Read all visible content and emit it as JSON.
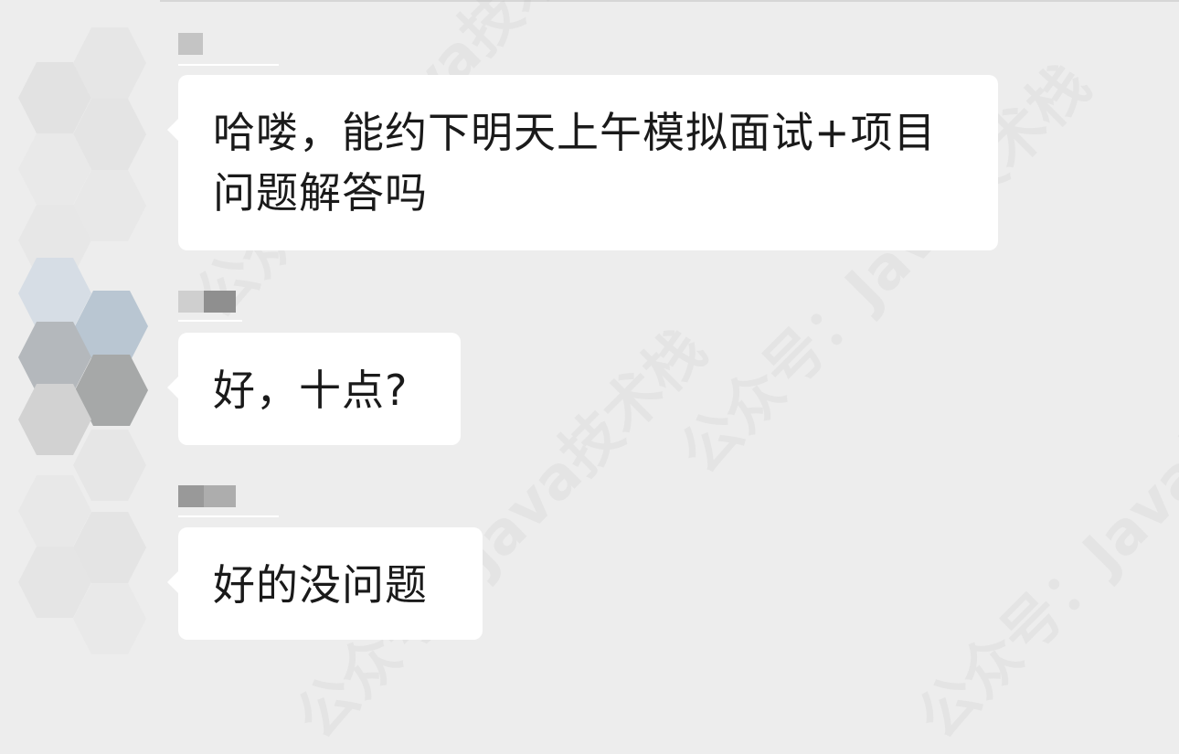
{
  "messages": [
    {
      "text": "哈喽，能约下明天上午模拟面试+项目问题解答吗"
    },
    {
      "text": "好，十点?"
    },
    {
      "text": "好的没问题"
    }
  ],
  "watermark": {
    "text": "公众号：Java技术栈"
  },
  "colors": {
    "background": "#ededed",
    "bubble": "#ffffff",
    "text": "#1a1a1a"
  }
}
